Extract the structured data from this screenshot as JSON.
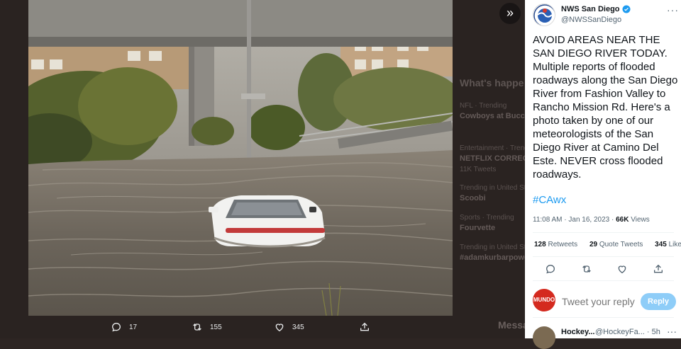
{
  "backdrop": {
    "section_heading": "What's happe",
    "rows": [
      {
        "meta": "NFL · Trending",
        "title": "Cowboys at Buccan"
      },
      {
        "meta": "Entertainment · Trending",
        "title": "NETFLIX CORRECT",
        "sub": "11K Tweets"
      },
      {
        "meta": "Trending in United States",
        "title": "Scoobi"
      },
      {
        "meta": "Sports · Trending",
        "title": "Fourvette"
      },
      {
        "meta": "Trending in United States",
        "title": "#adamkurbarpower"
      }
    ],
    "messages_label": "Messa"
  },
  "photo_actions": {
    "reply_count": "17",
    "retweet_count": "155",
    "like_count": "345"
  },
  "tweet": {
    "author_name": "NWS San Diego",
    "author_handle": "@NWSSanDiego",
    "text": "AVOID AREAS NEAR THE SAN DIEGO RIVER TODAY. Multiple reports of flooded roadways along the San Diego River from Fashion Valley to Rancho Mission Rd. Here's a photo taken by one of our meteorologists of the San Diego River at Camino Del Este. NEVER cross flooded roadways.",
    "hashtag": "#CAwx",
    "time": "11:08 AM · Jan 16, 2023 · ",
    "views_count": "66K",
    "views_label": " Views",
    "retweets_count": "128",
    "retweets_label": " Retweets",
    "quotes_count": "29",
    "quotes_label": " Quote Tweets",
    "likes_count": "345",
    "likes_label": " Likes"
  },
  "reply": {
    "avatar_text": "MUNDO",
    "placeholder": "Tweet your reply",
    "button_label": "Reply"
  },
  "next_reply": {
    "name": "Hockey...",
    "handle": "@HockeyFa... · 5h"
  },
  "colors": {
    "accent": "#1d9bf0",
    "reply_button": "#8ecdf8"
  }
}
